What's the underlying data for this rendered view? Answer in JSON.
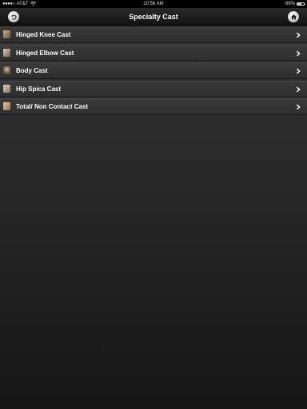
{
  "status_bar": {
    "carrier": "AT&T",
    "time": "10:56 AM",
    "battery": "66%",
    "battery_level": 0.66,
    "signal_icon": "signal-dots-icon",
    "wifi_icon": "wifi-icon"
  },
  "nav": {
    "title": "Specialty Cast",
    "back_icon": "back-arrow-icon",
    "home_icon": "home-icon",
    "button_color": "#e6e6e6"
  },
  "list": {
    "items": [
      {
        "label": "Hinged Knee Cast",
        "thumb_color": "#8a6a52"
      },
      {
        "label": "Hinged Elbow Cast",
        "thumb_color": "#9a7a5e"
      },
      {
        "label": "Body Cast",
        "thumb_color": "#7a5f4c"
      },
      {
        "label": "Hip Spica Cast",
        "thumb_color": "#a88c72"
      },
      {
        "label": "Total/ Non Contact Cast",
        "thumb_color": "#b08c6c"
      }
    ],
    "chevron_icon": "chevron-right-icon"
  },
  "colors": {
    "background_top": "#333333",
    "background_bottom": "#161616",
    "row": "#353535",
    "text": "#ffffff"
  }
}
